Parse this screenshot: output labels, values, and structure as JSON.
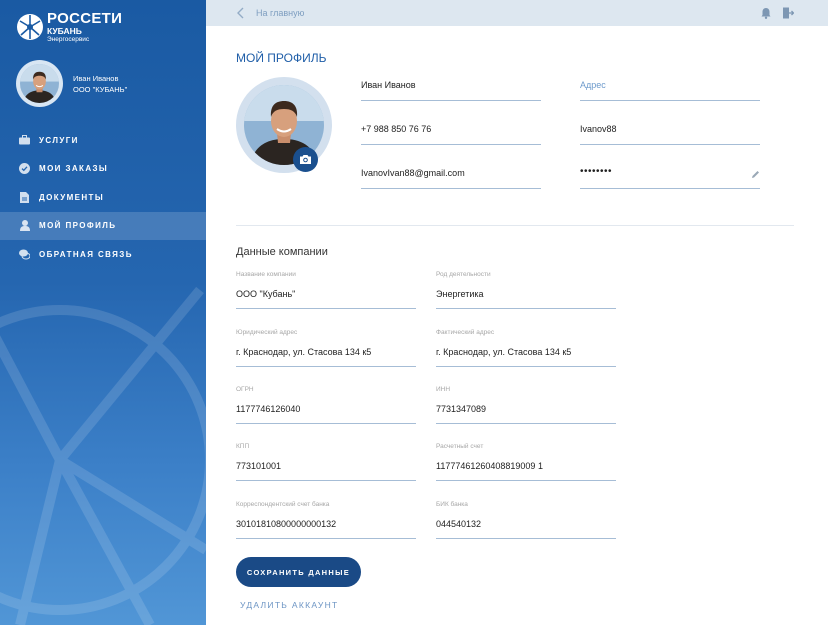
{
  "brand": {
    "title": "РОССЕТИ",
    "subtitle": "КУБАНЬ",
    "subtitle2": "Энергосервис"
  },
  "user": {
    "name": "Иван Иванов",
    "company": "ООО \"КУБАНЬ\""
  },
  "nav": {
    "items": [
      {
        "label": "УСЛУГИ",
        "icon": "briefcase-icon"
      },
      {
        "label": "МОИ ЗАКАЗЫ",
        "icon": "check-circle-icon"
      },
      {
        "label": "ДОКУМЕНТЫ",
        "icon": "document-icon"
      },
      {
        "label": "МОЙ ПРОФИЛЬ",
        "icon": "user-icon",
        "active": true
      },
      {
        "label": "ОБРАТНАЯ СВЯЗЬ",
        "icon": "chat-icon"
      }
    ]
  },
  "topbar": {
    "back_label": "На главную",
    "icons": [
      "notification-icon",
      "logout-icon"
    ]
  },
  "page_title": "МОЙ ПРОФИЛЬ",
  "profile": {
    "name": "Иван  Иванов",
    "phone": "+7 988 850 76 76",
    "email": "IvanovIvan88@gmail.com",
    "address_placeholder": "Адрес",
    "login": "Ivanov88",
    "password": "••••••••"
  },
  "company_section": {
    "title": "Данные компании",
    "fields": [
      {
        "label": "Название компании",
        "value": "ООО \"Кубань\""
      },
      {
        "label": "Род деятельности",
        "value": "Энергетика"
      },
      {
        "label": "Юридический адрес",
        "value": "г. Краснодар, ул. Стасова 134 к5"
      },
      {
        "label": "Фактический адрес",
        "value": "г. Краснодар, ул. Стасова 134 к5"
      },
      {
        "label": "ОГРН",
        "value": "1177746126040"
      },
      {
        "label": "ИНН",
        "value": " 7731347089"
      },
      {
        "label": "КПП",
        "value": "773101001"
      },
      {
        "label": "Расчетный счет",
        "value": "11777461260408819009 1"
      },
      {
        "label": "Корреспондентский счет банка",
        "value": "30101810800000000132"
      },
      {
        "label": "БИК банка",
        "value": "044540132"
      }
    ]
  },
  "actions": {
    "save_label": "СОХРАНИТЬ ДАННЫЕ",
    "delete_label": "УДАЛИТЬ АККАУНТ"
  },
  "colors": {
    "accent": "#1a4a86",
    "sidebar": "#2566b0",
    "link": "#6d95c4"
  }
}
